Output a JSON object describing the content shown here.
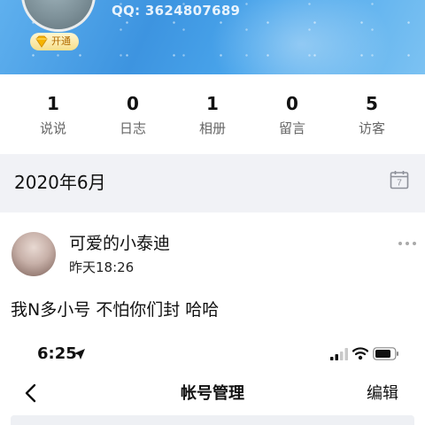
{
  "header": {
    "qq_label": "QQ: 3624807689",
    "vip_badge_label": "开通"
  },
  "stats": [
    {
      "value": "1",
      "label": "说说"
    },
    {
      "value": "0",
      "label": "日志"
    },
    {
      "value": "1",
      "label": "相册"
    },
    {
      "value": "0",
      "label": "留言"
    },
    {
      "value": "5",
      "label": "访客"
    }
  ],
  "timeline": {
    "month_label": "2020年6月",
    "calendar_icon": "calendar-icon",
    "calendar_day": "7"
  },
  "post": {
    "author": "可爱的小泰迪",
    "time": "昨天18:26",
    "text": "我N多小号 不怕你们封 哈哈",
    "more_icon": "more-dots-icon"
  },
  "embedded_screenshot": {
    "status_time": "6:25",
    "title": "帐号管理",
    "edit_label": "编辑",
    "back_icon": "chevron-left-icon"
  },
  "colors": {
    "banner": "#3d94e0",
    "month_bar_bg": "#f1f2f6",
    "vip_badge_text": "#b06a00"
  }
}
